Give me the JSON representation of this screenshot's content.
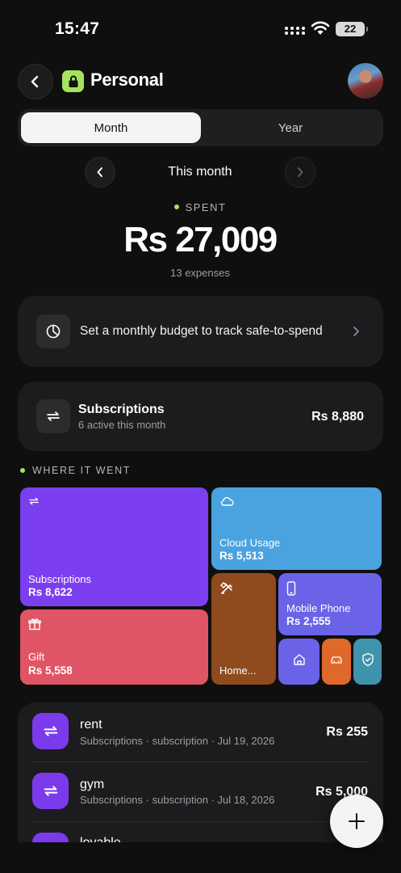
{
  "status_bar": {
    "time": "15:47",
    "battery": "22"
  },
  "header": {
    "title": "Personal"
  },
  "tabs": [
    {
      "label": "Month"
    },
    {
      "label": "Year"
    }
  ],
  "period": {
    "label": "This month"
  },
  "summary": {
    "label": "SPENT",
    "amount": "Rs 27,009",
    "count": "13 expenses"
  },
  "budget_prompt": {
    "text": "Set a monthly budget to track safe-to-spend"
  },
  "subscriptions_card": {
    "title": "Subscriptions",
    "subtitle": "6 active this month",
    "amount": "Rs 8,880"
  },
  "section": {
    "title": "WHERE IT WENT"
  },
  "categories": [
    {
      "name": "Subscriptions",
      "amount": "Rs 8,622",
      "color": "#7b3ff0",
      "icon": "repeat-icon"
    },
    {
      "name": "Cloud Usage",
      "amount": "Rs 5,513",
      "color": "#4aa3df",
      "icon": "cloud-icon"
    },
    {
      "name": "Gift",
      "amount": "Rs 5,558",
      "color": "#e05565",
      "icon": "gift-icon"
    },
    {
      "name": "Home...",
      "amount": "",
      "color": "#8f4a1e",
      "icon": "tools-icon"
    },
    {
      "name": "Mobile Phone",
      "amount": "Rs 2,555",
      "color": "#6a63e8",
      "icon": "phone-icon"
    },
    {
      "name": "",
      "amount": "",
      "color": "#6a63e8",
      "icon": "home-icon"
    },
    {
      "name": "",
      "amount": "",
      "color": "#e0682b",
      "icon": "car-icon"
    },
    {
      "name": "",
      "amount": "",
      "color": "#3f93ad",
      "icon": "shield-icon"
    }
  ],
  "transactions": [
    {
      "title": "rent",
      "meta": "Subscriptions · subscription · Jul 19, 2026",
      "amount": "Rs 255",
      "icon": "repeat-icon"
    },
    {
      "title": "gym",
      "meta": "Subscriptions · subscription · Jul 18, 2026",
      "amount": "Rs 5,000",
      "icon": "repeat-icon"
    },
    {
      "title": "lovable",
      "meta": "",
      "amount": "",
      "icon": "repeat-icon"
    }
  ],
  "colors": {
    "accent_green": "#a5e35e",
    "background": "#0f0f10",
    "card": "#1c1c1e",
    "purple": "#7c3aed"
  }
}
